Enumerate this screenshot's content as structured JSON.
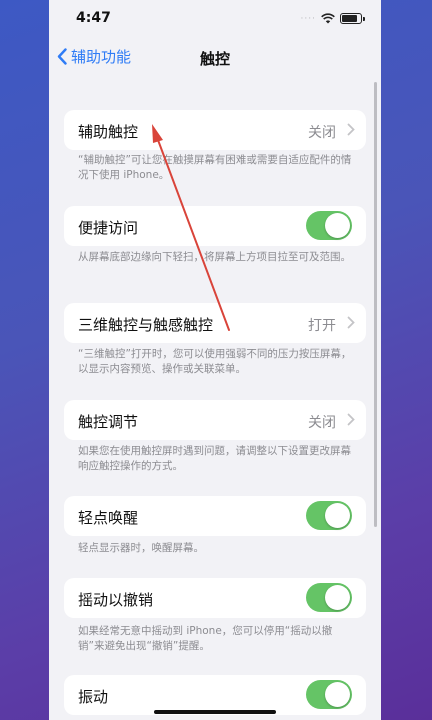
{
  "status_bar": {
    "time": "4:47",
    "signal": "····"
  },
  "nav": {
    "back_label": "辅助功能",
    "title": "触控"
  },
  "rows": [
    {
      "label": "辅助触控",
      "value": "关闭",
      "footer": "“辅助触控”可让您在触摸屏幕有困难或需要自适应配件的情况下使用 iPhone。"
    },
    {
      "label": "便捷访问",
      "toggle": true,
      "footer": "从屏幕底部边缘向下轻扫，将屏幕上方项目拉至可及范围。"
    },
    {
      "label": "三维触控与触感触控",
      "value": "打开",
      "footer": "“三维触控”打开时，您可以使用强弱不同的压力按压屏幕，以显示内容预览、操作或关联菜单。"
    },
    {
      "label": "触控调节",
      "value": "关闭",
      "footer": "如果您在使用触控屏时遇到问题，请调整以下设置更改屏幕响应触控操作的方式。"
    },
    {
      "label": "轻点唤醒",
      "toggle": true,
      "footer": "轻点显示器时，唤醒屏幕。"
    },
    {
      "label": "摇动以撤销",
      "toggle": true,
      "footer": "如果经常无意中摇动到 iPhone，您可以停用“摇动以撤销”来避免出现“撤销”提醒。"
    },
    {
      "label": "振动",
      "toggle": true
    }
  ],
  "colors": {
    "accent": "#2f7cf6",
    "toggle_on": "#65c466",
    "annotation": "#d9443a"
  }
}
